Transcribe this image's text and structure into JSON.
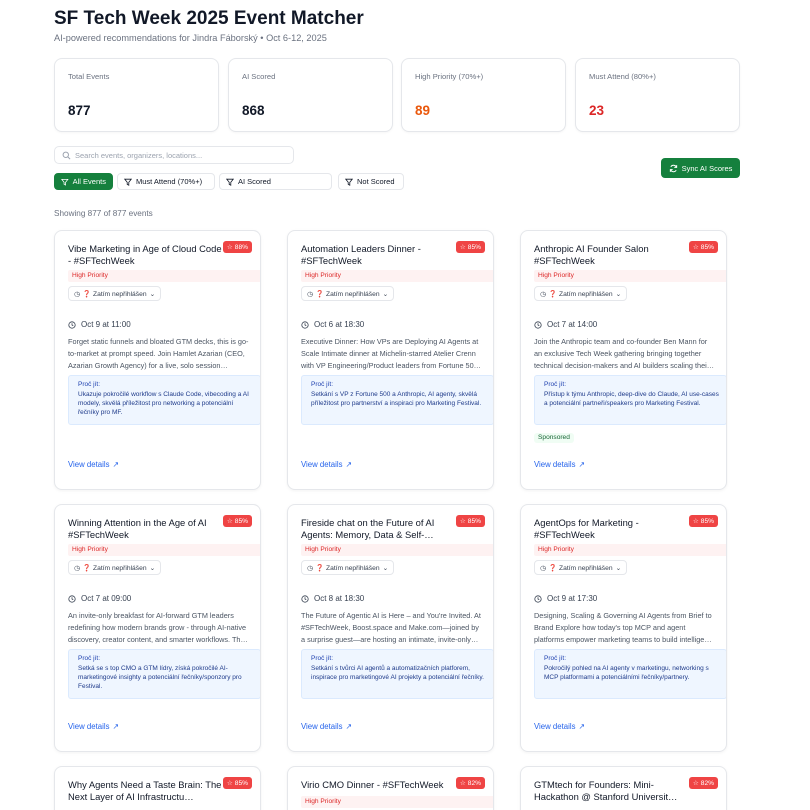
{
  "header": {
    "title": "SF Tech Week 2025 Event Matcher",
    "subtitle": "AI-powered recommendations for Jindra Fáborský • Oct 6-12, 2025"
  },
  "stats": [
    {
      "label": "Total Events",
      "value": "877"
    },
    {
      "label": "AI Scored",
      "value": "868"
    },
    {
      "label": "High Priority (70%+)",
      "value": "89"
    },
    {
      "label": "Must Attend (80%+)",
      "value": "23"
    }
  ],
  "search": {
    "placeholder": "Search events, organizers, locations...",
    "value": ""
  },
  "sync_button": "Sync AI Scores",
  "filters": [
    "All Events",
    "Must Attend (70%+)",
    "AI Scored",
    "Not Scored"
  ],
  "showing": "Showing 877 of 877 events",
  "colors": {
    "primary": "#15803d",
    "score": "#ef4444",
    "high_priority_bg": "#fef2f2",
    "why_bg": "#eff6ff",
    "link": "#2563eb"
  },
  "cards": [
    {
      "title": "Vibe Marketing in Age of Cloud Code - #SFTechWeek",
      "score": "88%",
      "priority": "High Priority",
      "registration": "❓ Zatím nepřihlášen",
      "date": "Oct 9 at 11:00",
      "description": "Forget static funnels and bloated GTM decks, this is go-to-market at prompt speed. Join Hamlet Azarian (CEO, Azarian Growth Agency) for a live, solo session…",
      "why_heading": "Proč jít:",
      "why_text": "Ukazuje pokročilé workflow s Claude Code, vibecoding a AI modely, skvělá příležitost pro networking a potenciální řečníky pro MF.",
      "view": "View details"
    },
    {
      "title": "Automation Leaders Dinner - #SFTechWeek",
      "score": "85%",
      "priority": "High Priority",
      "registration": "❓ Zatím nepřihlášen",
      "date": "Oct 6 at 18:30",
      "description": "Executive Dinner: How VPs are Deploying AI Agents at Scale Intimate dinner at Michelin-starred Atelier Crenn with VP Engineering/Product leaders from Fortune 50…",
      "why_heading": "Proč jít:",
      "why_text": "Setkání s VP z Fortune 500 a Anthropic, AI agenty, skvělá příležitost pro partnerství a inspiraci pro Marketing Festival.",
      "view": "View details"
    },
    {
      "title": "Anthropic AI Founder Salon #SFTechWeek",
      "score": "85%",
      "priority": "High Priority",
      "registration": "❓ Zatím nepřihlášen",
      "date": "Oct 7 at 14:00",
      "description": "Join the Anthropic team and co-founder Ben Mann for an exclusive Tech Week gathering bringing together technical decision-makers and AI builders scaling thei…",
      "why_heading": "Proč jít:",
      "why_text": "Přístup k týmu Anthropic, deep-dive do Claude, AI use-cases a potenciální partneři/speakers pro Marketing Festival.",
      "sponsored": "Sponsored",
      "view": "View details"
    },
    {
      "title": "Winning Attention in the Age of AI #SFTechWeek",
      "score": "85%",
      "priority": "High Priority",
      "registration": "❓ Zatím nepřihlášen",
      "date": "Oct 7 at 09:00",
      "description": "An invite-only breakfast for AI-forward GTM leaders redefining how modern brands grow - through AI-native discovery, creator content, and smarter workflows. Th…",
      "why_heading": "Proč jít:",
      "why_text": "Setká se s top CMO a GTM lídry, získá pokročilé AI-marketingové insighty a potenciální řečníky/sponzory pro Festival.",
      "view": "View details"
    },
    {
      "title": "Fireside chat on the Future of AI Agents: Memory, Data & Self-…",
      "score": "85%",
      "priority": "High Priority",
      "registration": "❓ Zatím nepřihlášen",
      "date": "Oct 8 at 18:30",
      "description": "The Future of Agentic AI is Here – and You're Invited. At #SFTechWeek, Boost.space and Make.com—joined by a surprise guest—are hosting an intimate, invite-only…",
      "why_heading": "Proč jít:",
      "why_text": "Setkání s tvůrci AI agentů a automatizačních platforem, inspirace pro marketingové AI projekty a potenciální řečníky.",
      "view": "View details"
    },
    {
      "title": "AgentOps for Marketing - #SFTechWeek",
      "score": "85%",
      "priority": "High Priority",
      "registration": "❓ Zatím nepřihlášen",
      "date": "Oct 9 at 17:30",
      "description": "Designing, Scaling & Governing AI Agents from Brief to Brand Explore how today's top MCP and agent platforms empower marketing teams to build intellige…",
      "why_heading": "Proč jít:",
      "why_text": "Pokročilý pohled na AI agenty v marketingu, networking s MCP platformami a potenciálními řečníky/partnery.",
      "view": "View details"
    },
    {
      "title": "Why Agents Need a Taste Brain: The Next Layer of AI Infrastructu…",
      "score": "85%"
    },
    {
      "title": "Virio CMO Dinner - #SFTechWeek",
      "score": "82%",
      "priority": "High Priority"
    },
    {
      "title": "GTMtech for Founders: Mini-Hackathon @ Stanford Universit…",
      "score": "82%"
    }
  ]
}
